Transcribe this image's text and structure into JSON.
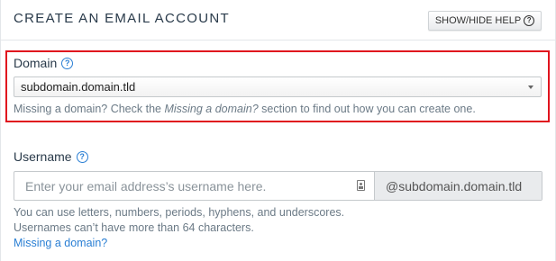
{
  "header": {
    "title": "CREATE AN EMAIL ACCOUNT",
    "help_button": "SHOW/HIDE HELP",
    "help_icon": "?"
  },
  "domain": {
    "label": "Domain",
    "help_icon": "?",
    "selected": "subdomain.domain.tld",
    "hint_prefix": "Missing a domain? Check the ",
    "hint_italic": "Missing a domain?",
    "hint_suffix": " section to find out how you can create one."
  },
  "username": {
    "label": "Username",
    "help_icon": "?",
    "placeholder": "Enter your email address’s username here.",
    "suffix": "@subdomain.domain.tld",
    "hint_line1": "You can use letters, numbers, periods, hyphens, and underscores.",
    "hint_line2": "Usernames can’t have more than 64 characters.",
    "missing_link": "Missing a domain?"
  },
  "colors": {
    "highlight_border": "#e0141e",
    "link": "#2a7fd4"
  }
}
